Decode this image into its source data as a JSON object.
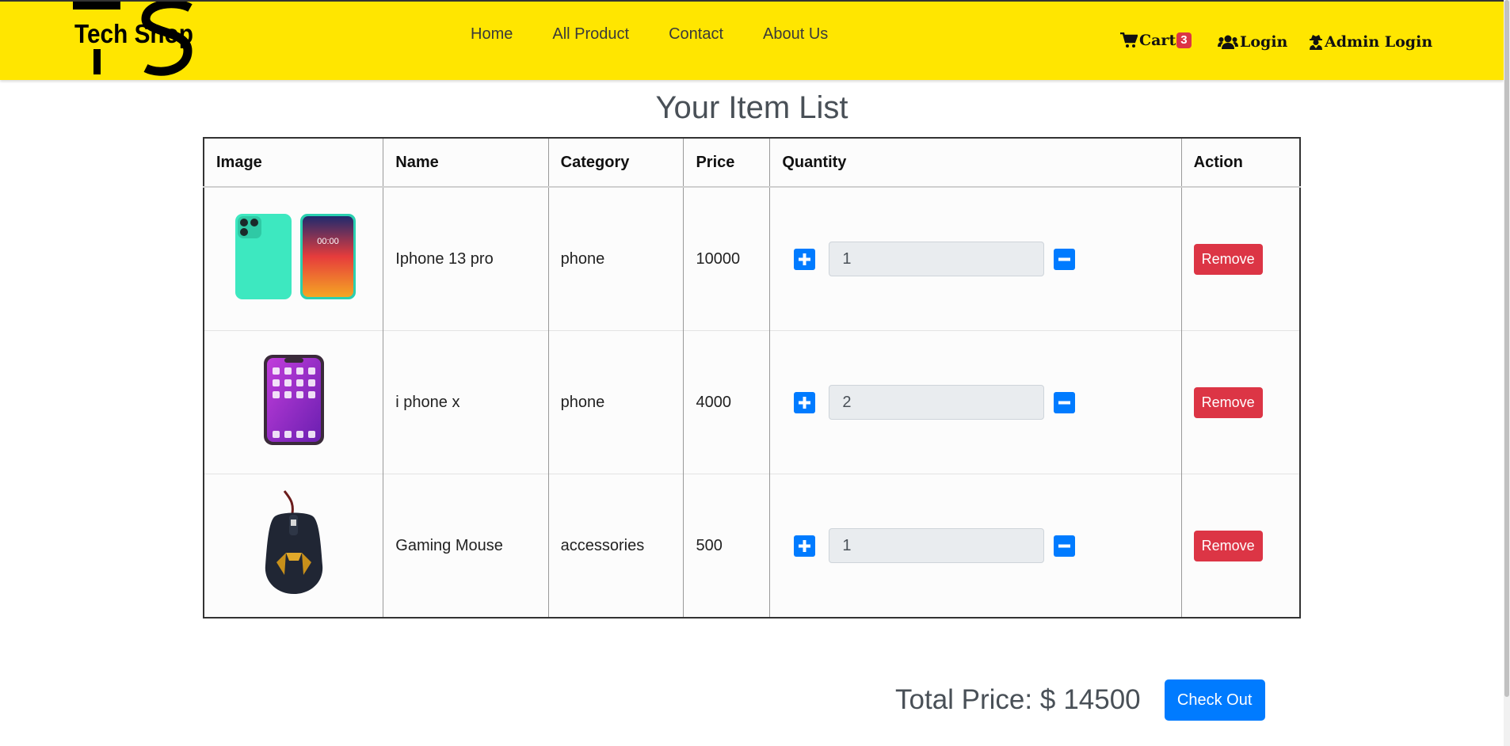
{
  "brand": {
    "logo_text": "Tech Shop"
  },
  "nav": {
    "links": [
      {
        "label": "Home"
      },
      {
        "label": "All Product"
      },
      {
        "label": "Contact"
      },
      {
        "label": "About Us"
      }
    ],
    "cart_label": "Cart",
    "cart_count": "3",
    "login_label": "Login",
    "admin_login_label": "Admin Login"
  },
  "page_title": "Your Item List",
  "table": {
    "headers": [
      "Image",
      "Name",
      "Category",
      "Price",
      "Quantity",
      "Action"
    ],
    "rows": [
      {
        "name": "Iphone 13 pro",
        "category": "phone",
        "price": "10000",
        "quantity": "1",
        "image": "iphone-13-pro",
        "action": "Remove"
      },
      {
        "name": "i phone x",
        "category": "phone",
        "price": "4000",
        "quantity": "2",
        "image": "iphone-x",
        "action": "Remove"
      },
      {
        "name": "Gaming Mouse",
        "category": "accessories",
        "price": "500",
        "quantity": "1",
        "image": "gaming-mouse",
        "action": "Remove"
      }
    ]
  },
  "summary": {
    "total_label": "Total Price: $",
    "total_value": "14500",
    "checkout_label": "Check Out"
  },
  "colors": {
    "navbar_bg": "#ffe600",
    "primary": "#007bff",
    "danger": "#dc3545"
  },
  "icons": [
    "cart-icon",
    "users-icon",
    "user-secret-icon",
    "plus-icon",
    "minus-icon"
  ]
}
